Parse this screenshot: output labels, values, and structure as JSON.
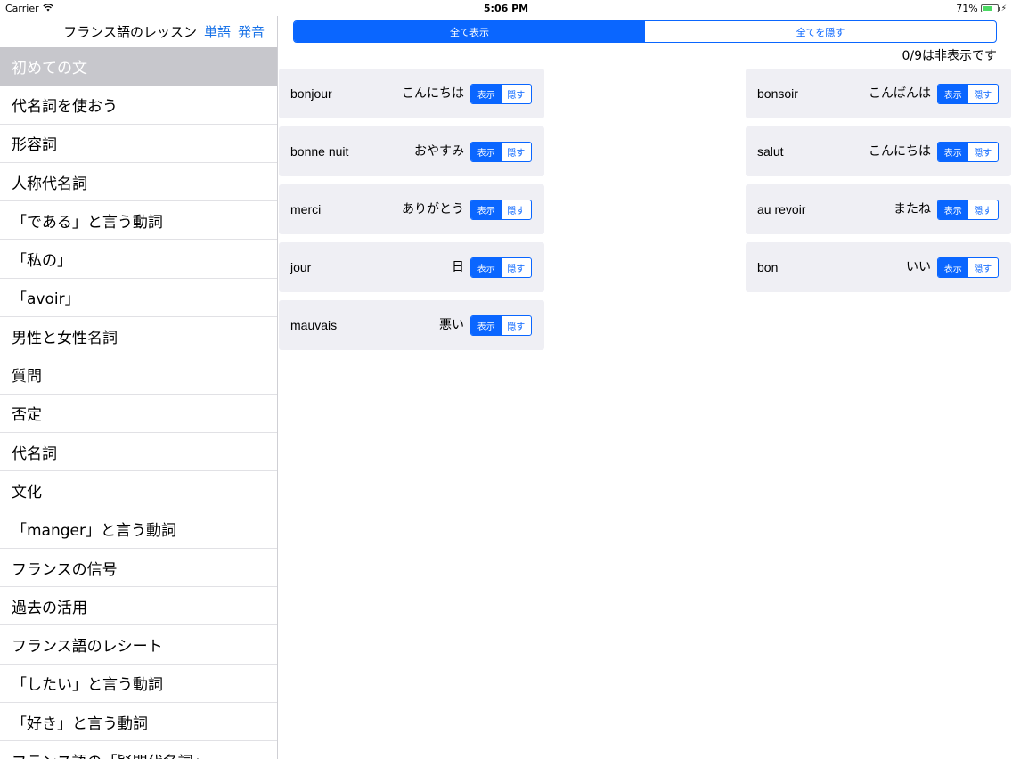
{
  "status_bar": {
    "carrier": "Carrier",
    "time": "5:06 PM",
    "battery": "71%"
  },
  "sidebar": {
    "title": "フランス語のレッスン",
    "links": [
      "単語",
      "発音"
    ],
    "items": [
      "初めての文",
      "代名詞を使おう",
      "形容詞",
      "人称代名詞",
      "「である」と言う動詞",
      "「私の」",
      "「avoir」",
      "男性と女性名詞",
      "質問",
      "否定",
      "代名詞",
      "文化",
      "「manger」と言う動詞",
      "フランスの信号",
      "過去の活用",
      "フランス語のレシート",
      "「したい」と言う動詞",
      "「好き」と言う動詞",
      "フランス語の「疑問代名詞」"
    ]
  },
  "main": {
    "segment": {
      "show_all": "全て表示",
      "hide_all": "全てを隠す"
    },
    "hidden_count": "0/9は非表示です",
    "toggle": {
      "show": "表示",
      "hide": "隠す"
    },
    "left_cards": [
      {
        "word": "bonjour",
        "meaning": "こんにちは"
      },
      {
        "word": "bonne nuit",
        "meaning": "おやすみ"
      },
      {
        "word": "merci",
        "meaning": "ありがとう"
      },
      {
        "word": "jour",
        "meaning": "日"
      },
      {
        "word": "mauvais",
        "meaning": "悪い"
      }
    ],
    "right_cards": [
      {
        "word": "bonsoir",
        "meaning": "こんばんは"
      },
      {
        "word": "salut",
        "meaning": "こんにちは"
      },
      {
        "word": "au revoir",
        "meaning": "またね"
      },
      {
        "word": "bon",
        "meaning": "いい"
      }
    ]
  },
  "colors": {
    "accent": "#0a66ff",
    "card_bg": "#efeff4",
    "selected_bg": "#c7c7cc"
  }
}
